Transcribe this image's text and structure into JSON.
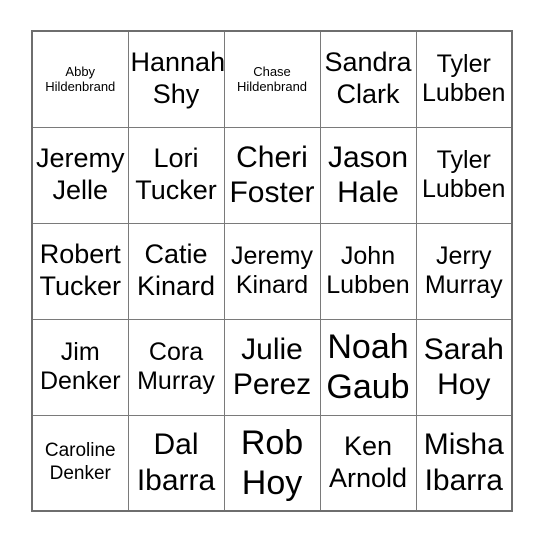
{
  "card": {
    "type": "bingo-card",
    "rows": 5,
    "columns": 5,
    "background_color": "#ffffff",
    "text_color": "#000000",
    "border_color": "#6e6e6e",
    "gridline_color": "#7a7a7a",
    "cells": [
      [
        {
          "first": "Abby",
          "last": "Hildenbrand",
          "size": "fs-xs"
        },
        {
          "first": "Hannah",
          "last": "Shy",
          "size": "fs-xl"
        },
        {
          "first": "Chase",
          "last": "Hildenbrand",
          "size": "fs-xs"
        },
        {
          "first": "Sandra",
          "last": "Clark",
          "size": "fs-xl"
        },
        {
          "first": "Tyler",
          "last": "Lubben",
          "size": "fs-lg"
        }
      ],
      [
        {
          "first": "Jeremy",
          "last": "Jelle",
          "size": "fs-xl"
        },
        {
          "first": "Lori",
          "last": "Tucker",
          "size": "fs-xl"
        },
        {
          "first": "Cheri",
          "last": "Foster",
          "size": "fs-xxl"
        },
        {
          "first": "Jason",
          "last": "Hale",
          "size": "fs-xxl"
        },
        {
          "first": "Tyler",
          "last": "Lubben",
          "size": "fs-lg"
        }
      ],
      [
        {
          "first": "Robert",
          "last": "Tucker",
          "size": "fs-xl"
        },
        {
          "first": "Catie",
          "last": "Kinard",
          "size": "fs-xl"
        },
        {
          "first": "Jeremy",
          "last": "Kinard",
          "size": "fs-lg"
        },
        {
          "first": "John",
          "last": "Lubben",
          "size": "fs-lg"
        },
        {
          "first": "Jerry",
          "last": "Murray",
          "size": "fs-lg"
        }
      ],
      [
        {
          "first": "Jim",
          "last": "Denker",
          "size": "fs-lg"
        },
        {
          "first": "Cora",
          "last": "Murray",
          "size": "fs-lg"
        },
        {
          "first": "Julie",
          "last": "Perez",
          "size": "fs-xxl"
        },
        {
          "first": "Noah",
          "last": "Gaub",
          "size": "fs-huge"
        },
        {
          "first": "Sarah",
          "last": "Hoy",
          "size": "fs-xxl"
        }
      ],
      [
        {
          "first": "Caroline",
          "last": "Denker",
          "size": "fs-sm"
        },
        {
          "first": "Dal",
          "last": "Ibarra",
          "size": "fs-xxl"
        },
        {
          "first": "Rob",
          "last": "Hoy",
          "size": "fs-huge"
        },
        {
          "first": "Ken",
          "last": "Arnold",
          "size": "fs-xl"
        },
        {
          "first": "Misha",
          "last": "Ibarra",
          "size": "fs-xxl"
        }
      ]
    ]
  }
}
